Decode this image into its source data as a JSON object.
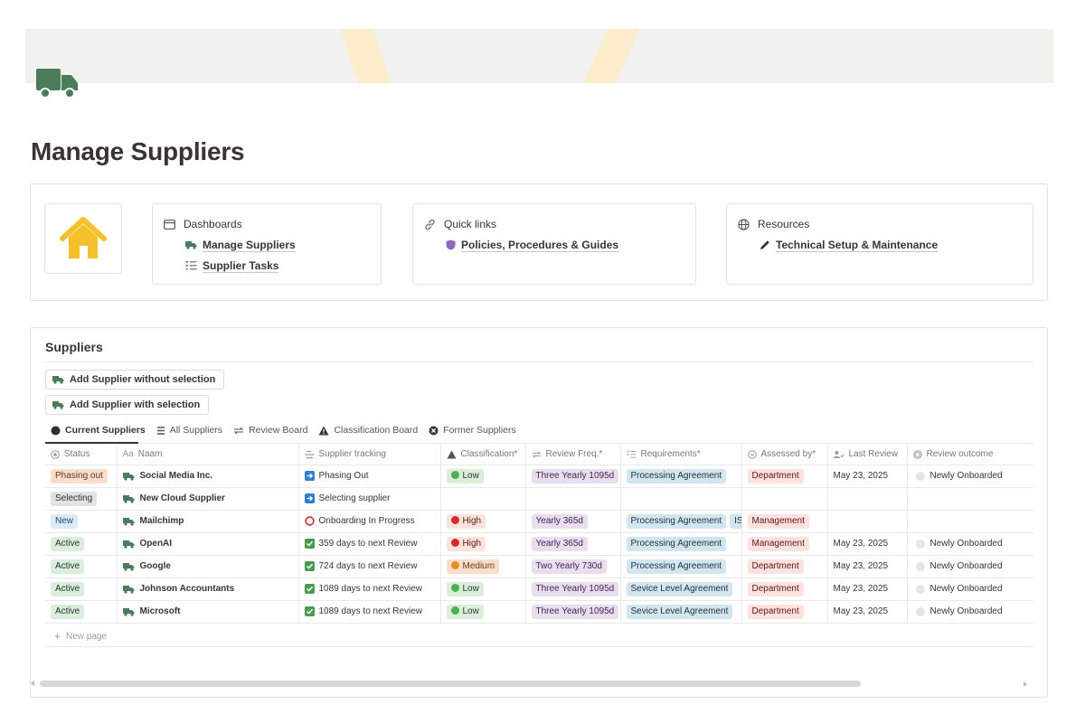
{
  "page": {
    "title": "Manage Suppliers",
    "icon": "truck-icon"
  },
  "colors": {
    "accent_green": "#4a7c59",
    "home_yellow": "#f5c02b"
  },
  "cards": {
    "dashboards": {
      "title": "Dashboards",
      "links": [
        "Manage Suppliers",
        "Supplier Tasks"
      ]
    },
    "quick_links": {
      "title": "Quick links",
      "links": [
        "Policies, Procedures & Guides"
      ]
    },
    "resources": {
      "title": "Resources",
      "links": [
        "Technical Setup & Maintenance"
      ]
    }
  },
  "db": {
    "title": "Suppliers",
    "buttons": [
      "Add Supplier without selection",
      "Add Supplier with selection"
    ],
    "views": [
      "Current Suppliers",
      "All Suppliers",
      "Review Board",
      "Classification Board",
      "Former Suppliers"
    ],
    "columns": [
      "Status",
      "Naam",
      "Supplier tracking",
      "Classification*",
      "Review Freq.*",
      "Requirements*",
      "Assessed by*",
      "Last Review",
      "Review outcome"
    ],
    "new_page": "New page",
    "rows": [
      {
        "status": "Phasing out",
        "name": "Social Media Inc.",
        "tracking": "Phasing Out",
        "tracking_icon": "arrow-box-icon",
        "classification": "Low",
        "freq": "Three Yearly 1095d",
        "requirements": [
          "Processing Agreement"
        ],
        "assessed": "Department",
        "last_review": "May 23, 2025",
        "outcome": "Newly Onboarded"
      },
      {
        "status": "Selecting",
        "name": "New Cloud Supplier",
        "tracking": "Selecting supplier",
        "tracking_icon": "arrow-box-icon",
        "classification": "",
        "freq": "",
        "requirements": [],
        "assessed": "",
        "last_review": "",
        "outcome": ""
      },
      {
        "status": "New",
        "name": "Mailchimp",
        "tracking": "Onboarding In Progress",
        "tracking_icon": "circle-icon",
        "classification": "High",
        "freq": "Yearly 365d",
        "requirements": [
          "Processing Agreement",
          "IS"
        ],
        "assessed": "Management",
        "last_review": "",
        "outcome": ""
      },
      {
        "status": "Active",
        "name": "OpenAI",
        "tracking": "359 days to next Review",
        "tracking_icon": "check-box-icon",
        "classification": "High",
        "freq": "Yearly 365d",
        "requirements": [
          "Processing Agreement"
        ],
        "assessed": "Management",
        "last_review": "May 23, 2025",
        "outcome": "Newly Onboarded"
      },
      {
        "status": "Active",
        "name": "Google",
        "tracking": "724 days to next Review",
        "tracking_icon": "check-box-icon",
        "classification": "Medium",
        "freq": "Two Yearly 730d",
        "requirements": [
          "Processing Agreement"
        ],
        "assessed": "Department",
        "last_review": "May 23, 2025",
        "outcome": "Newly Onboarded"
      },
      {
        "status": "Active",
        "name": "Johnson Accountants",
        "tracking": "1089 days to next Review",
        "tracking_icon": "check-box-icon",
        "classification": "Low",
        "freq": "Three Yearly 1095d",
        "requirements": [
          "Sevice Level Agreement"
        ],
        "assessed": "Department",
        "last_review": "May 23, 2025",
        "outcome": "Newly Onboarded"
      },
      {
        "status": "Active",
        "name": "Microsoft",
        "tracking": "1089 days to next Review",
        "tracking_icon": "check-box-icon",
        "classification": "Low",
        "freq": "Three Yearly 1095d",
        "requirements": [
          "Sevice Level Agreement"
        ],
        "assessed": "Department",
        "last_review": "May 23, 2025",
        "outcome": "Newly Onboarded"
      }
    ]
  }
}
